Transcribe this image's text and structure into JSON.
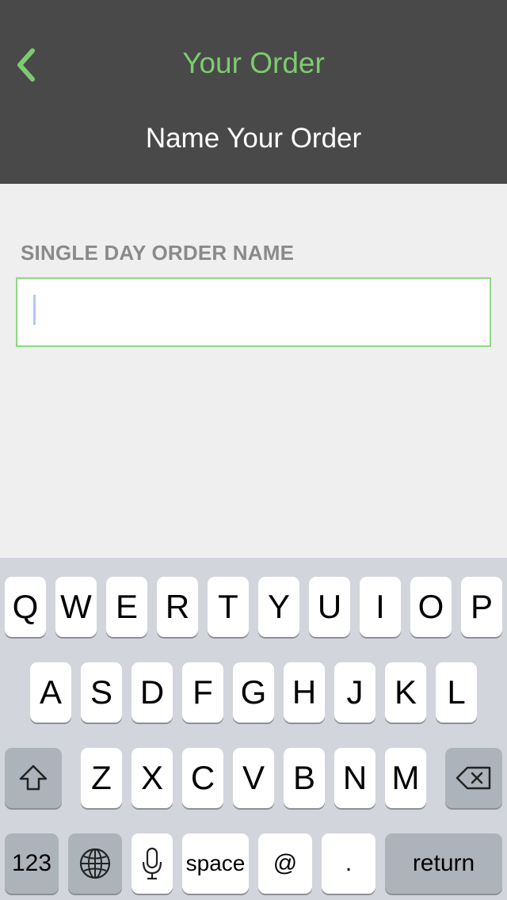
{
  "nav": {
    "title": "Your Order",
    "back_icon": "chevron-left-icon",
    "accent_color": "#7ccc6e",
    "background_color": "#494949"
  },
  "header": {
    "subtitle": "Name Your Order"
  },
  "form": {
    "label": "SINGLE DAY ORDER NAME",
    "input_value": "",
    "input_border_color": "#8fd783"
  },
  "keyboard": {
    "row1": [
      "Q",
      "W",
      "E",
      "R",
      "T",
      "Y",
      "U",
      "I",
      "O",
      "P"
    ],
    "row2": [
      "A",
      "S",
      "D",
      "F",
      "G",
      "H",
      "J",
      "K",
      "L"
    ],
    "row3": [
      "Z",
      "X",
      "C",
      "V",
      "B",
      "N",
      "M"
    ],
    "shift_icon": "shift-icon",
    "delete_icon": "backspace-icon",
    "numbers_label": "123",
    "globe_icon": "globe-icon",
    "mic_icon": "microphone-icon",
    "space_label": "space",
    "at_label": "@",
    "dot_label": ".",
    "return_label": "return"
  }
}
